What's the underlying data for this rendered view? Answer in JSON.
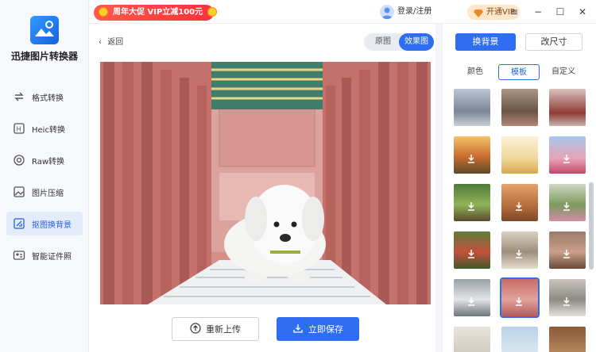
{
  "app": {
    "title": "迅捷图片转换器"
  },
  "sidebar": {
    "items": [
      {
        "label": "格式转换",
        "icon": "format-convert-icon"
      },
      {
        "label": "Heic转换",
        "icon": "heic-icon"
      },
      {
        "label": "Raw转换",
        "icon": "raw-icon"
      },
      {
        "label": "图片压缩",
        "icon": "image-compress-icon"
      },
      {
        "label": "抠图换背景",
        "icon": "cutout-icon",
        "active": true
      },
      {
        "label": "智能证件照",
        "icon": "id-photo-icon"
      }
    ]
  },
  "topbar": {
    "promo": "周年大促 VIP立减100元",
    "login": "登录/注册",
    "vip": "开通VIP",
    "controls": [
      "menu-icon",
      "minimize-icon",
      "maximize-icon",
      "close-icon"
    ]
  },
  "main": {
    "back": "返回",
    "view_original": "原图",
    "view_effect": "效果图",
    "reupload": "重新上传",
    "save": "立即保存"
  },
  "right": {
    "tab_background": "换背景",
    "tab_size": "改尺寸",
    "sub_tabs": [
      "颜色",
      "模板",
      "自定义"
    ],
    "active_sub_tab": "模板"
  },
  "colors": {
    "accent": "#2f6df2",
    "promo": "#ff3b3b"
  }
}
